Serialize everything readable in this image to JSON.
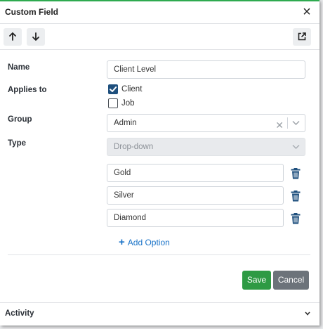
{
  "dialog": {
    "title": "Custom Field",
    "close_icon": "×"
  },
  "toolbar": {
    "move_up_icon": "arrow-up-icon",
    "move_down_icon": "arrow-down-icon",
    "popout_icon": "external-link-icon"
  },
  "form": {
    "name_label": "Name",
    "name_value": "Client Level",
    "applies_to_label": "Applies to",
    "applies_to_options": [
      {
        "label": "Client",
        "checked": true
      },
      {
        "label": "Job",
        "checked": false
      }
    ],
    "group_label": "Group",
    "group_value": "Admin",
    "type_label": "Type",
    "type_value": "Drop-down",
    "options": [
      "Gold",
      "Silver",
      "Diamond"
    ],
    "add_option_label": "Add Option"
  },
  "actions": {
    "save_label": "Save",
    "cancel_label": "Cancel"
  },
  "activity": {
    "label": "Activity"
  },
  "colors": {
    "accent_green": "#2e9a44",
    "link_blue": "#1a73c8",
    "checkbox_navy": "#1e4f7d",
    "trash_navy": "#1e4f7d"
  }
}
